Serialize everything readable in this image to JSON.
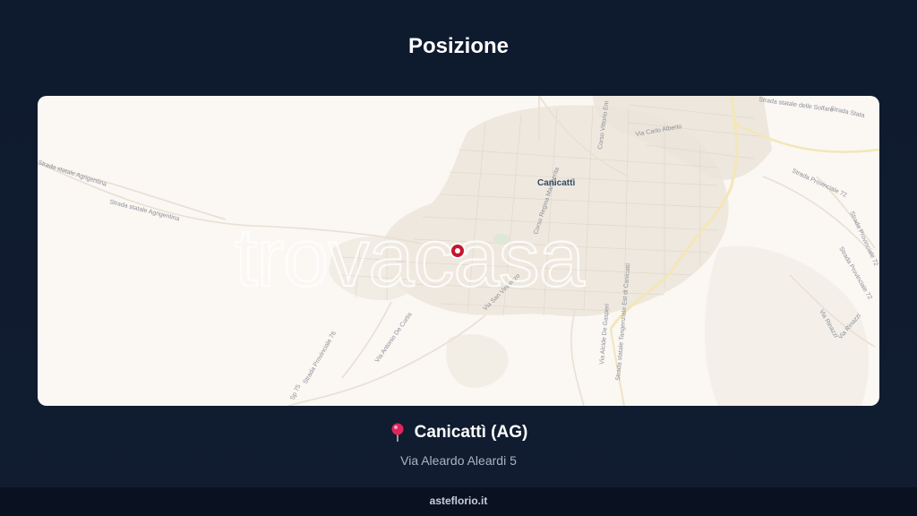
{
  "page": {
    "title": "Posizione"
  },
  "map": {
    "watermark": "trovacasa",
    "city_label": "Canicattì",
    "streets": {
      "s1": "Strada statale Agrigentina",
      "s2": "Strada statale Agrigentina",
      "s3": "Corso Vittorio Em",
      "s4": "Via Carlo Alberto",
      "s5": "Strada statale delle Solfare",
      "s6": "Strada Stata",
      "s7": "Strada Provinciale 72",
      "s8": "Strada Provinciale 72",
      "s9": "Strada Provinciale 72",
      "s10": "Via San Vincenzo",
      "s11": "Via Antonio De Curtis",
      "s12": "Strada Provinciale 76",
      "s13": "Via Alcide De Gasperi",
      "s14": "Strada statale Tangenziale Est di Canicattì",
      "s15": "Via Rinazzi",
      "s16": "Via Rinazzi",
      "s17": "Corso Regina Margherita",
      "s18": "Sp 75"
    },
    "marker_icon": "location-marker-icon",
    "colors": {
      "background": "#fbf7f3",
      "urban": "#ece6dd",
      "major_road": "#f3e7b8",
      "marker": "#c4162e"
    }
  },
  "location": {
    "pin_icon": "round-pushpin-icon",
    "city": "Canicattì (AG)",
    "address": "Via Aleardo Aleardi 5"
  },
  "footer": {
    "site": "asteflorio.it"
  }
}
